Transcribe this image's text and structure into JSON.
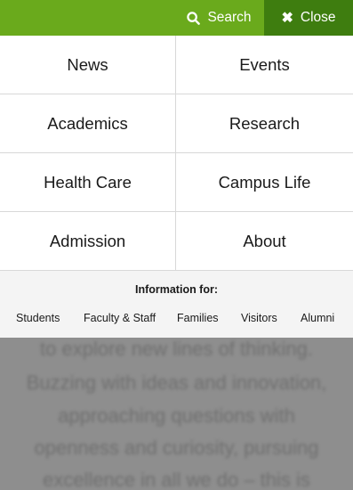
{
  "topbar": {
    "search_label": "Search",
    "close_label": "Close",
    "accent": "#6aaa1c",
    "close_bg": "#3e7d0f"
  },
  "menu": {
    "items": [
      {
        "label": "News"
      },
      {
        "label": "Events"
      },
      {
        "label": "Academics"
      },
      {
        "label": "Research"
      },
      {
        "label": "Health Care"
      },
      {
        "label": "Campus Life"
      },
      {
        "label": "Admission"
      },
      {
        "label": "About"
      }
    ]
  },
  "info": {
    "title": "Information for:",
    "audiences": [
      {
        "label": "Students"
      },
      {
        "label": "Faculty & Staff"
      },
      {
        "label": "Families"
      },
      {
        "label": "Visitors"
      },
      {
        "label": "Alumni"
      }
    ]
  },
  "background_text": {
    "lines": [
      "to explore new lines of thinking.",
      "Buzzing with ideas and innovation,",
      "approaching questions with",
      "openness and curiosity, pursuing",
      "excellence in all we do – this is"
    ]
  }
}
